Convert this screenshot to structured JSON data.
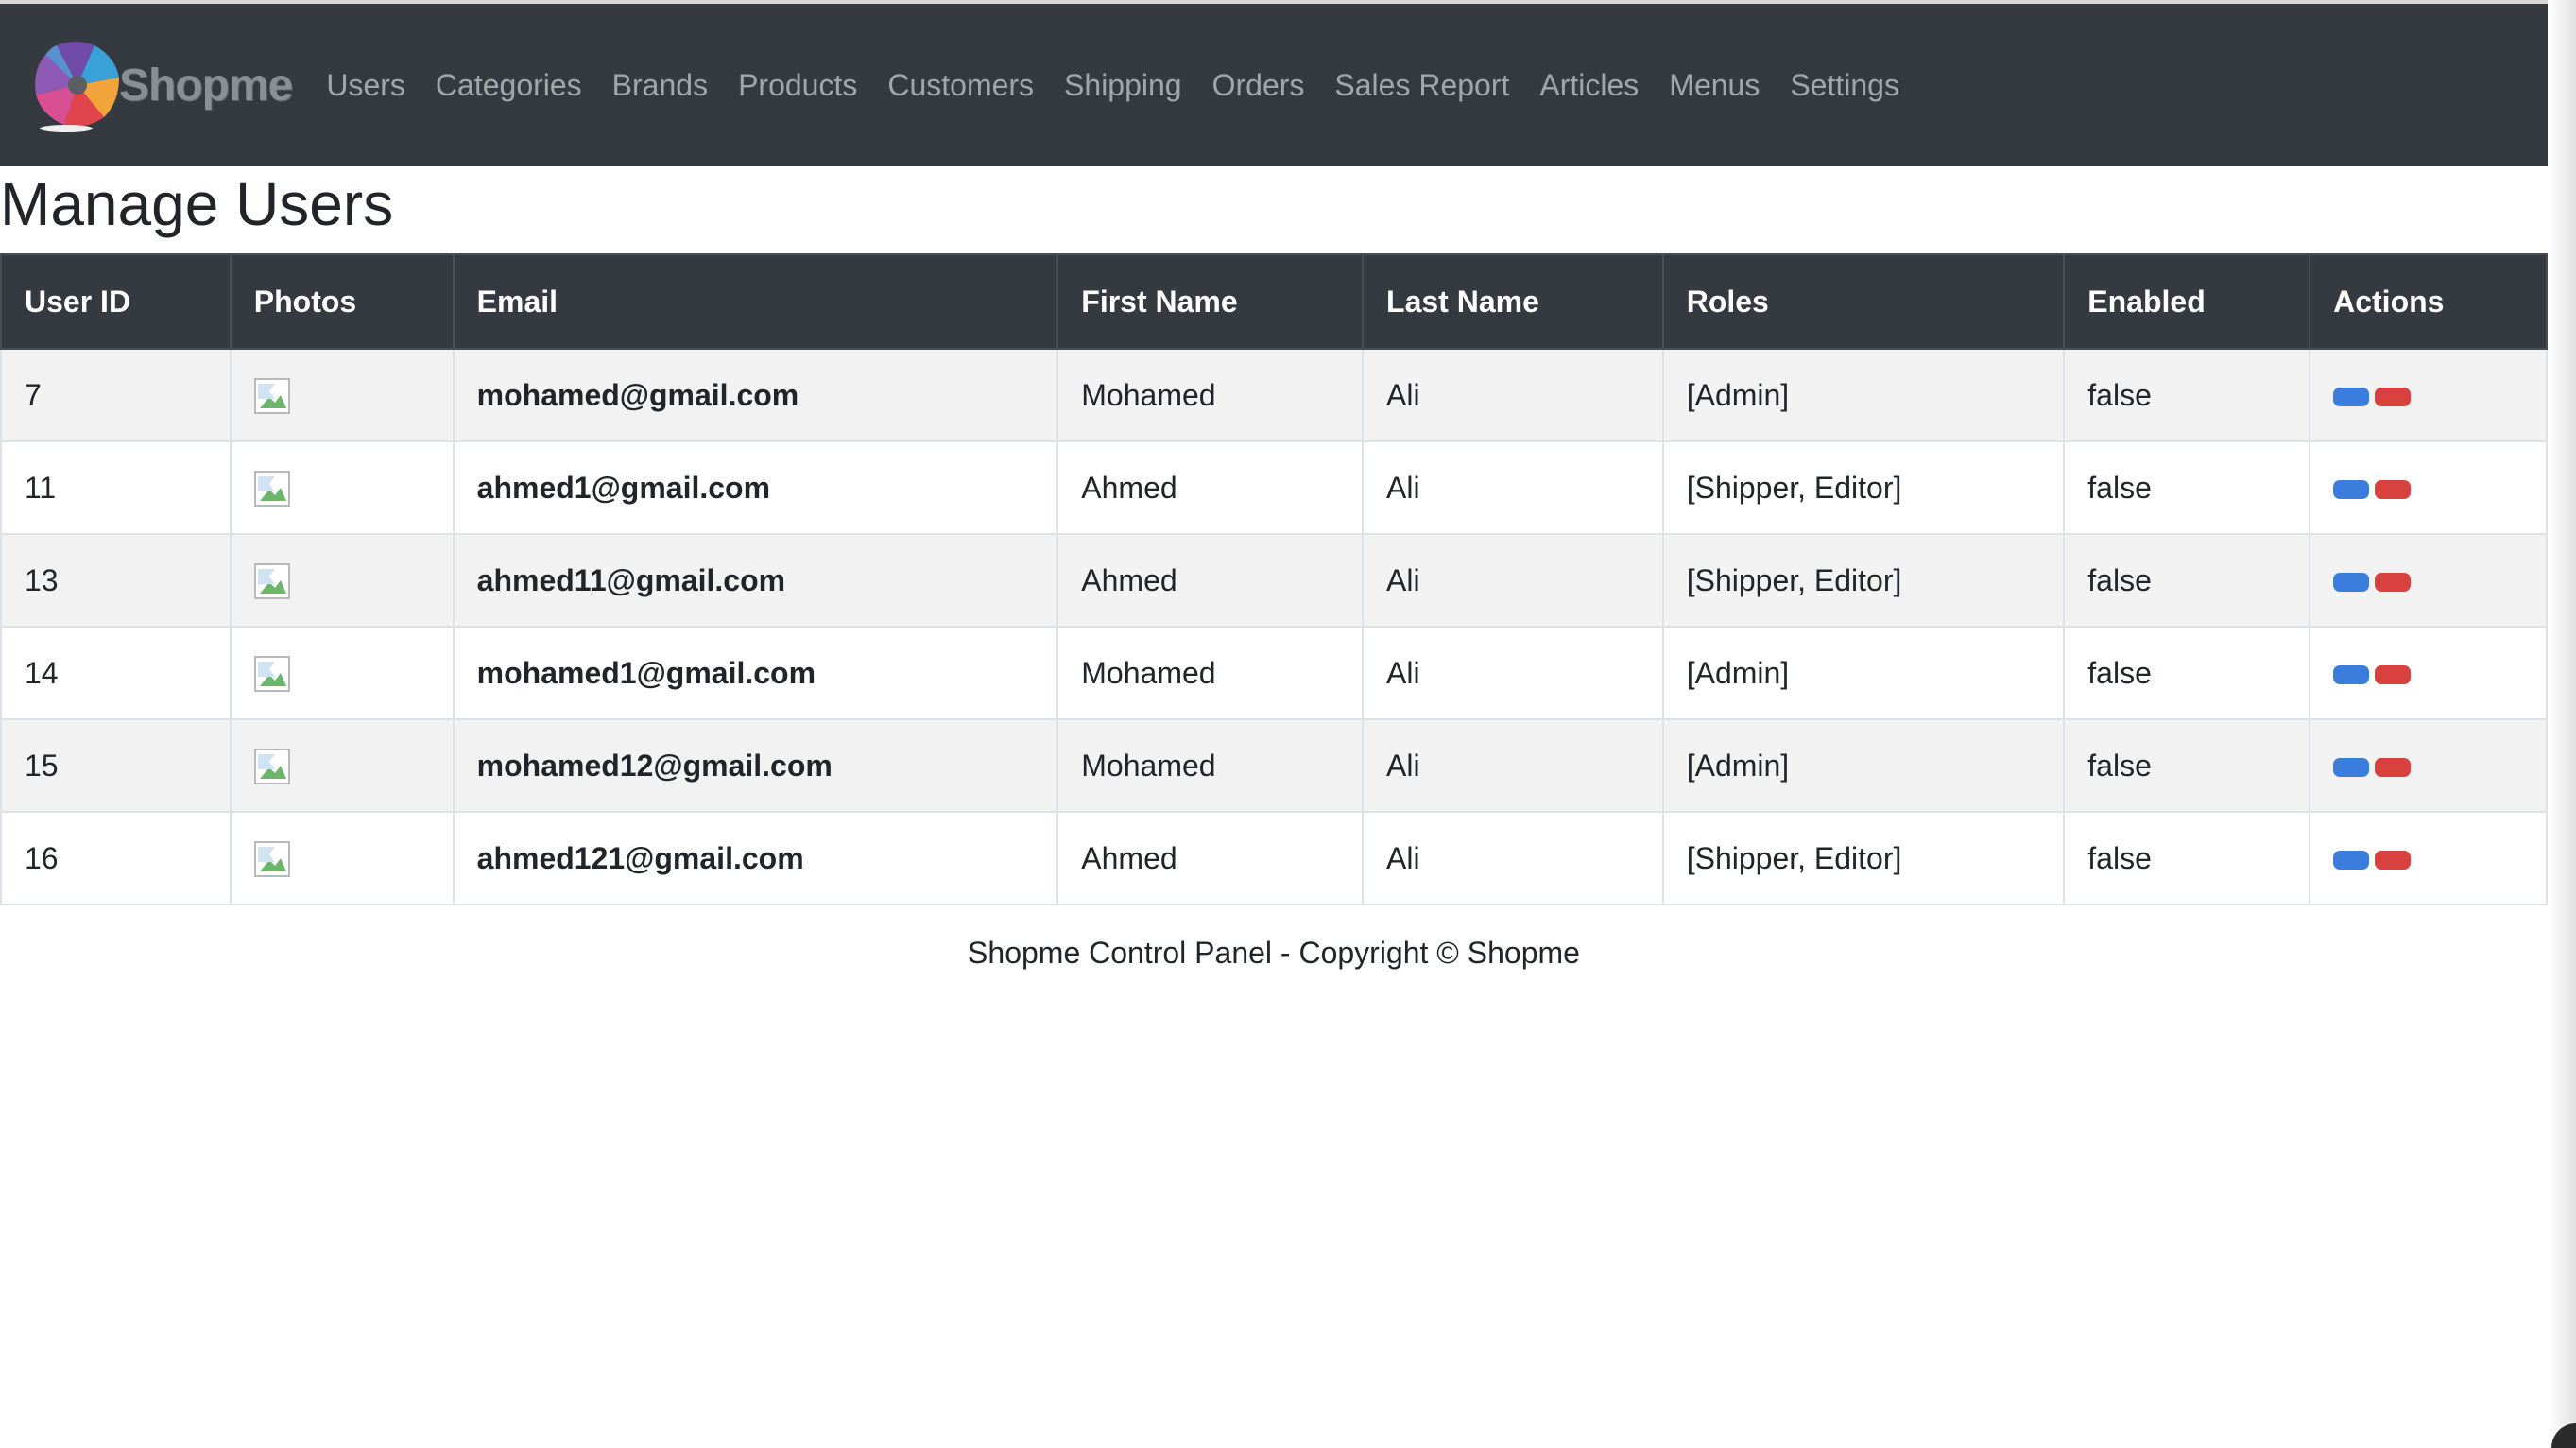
{
  "navbar": {
    "brand": "Shopme",
    "links": [
      {
        "label": "Users"
      },
      {
        "label": "Categories"
      },
      {
        "label": "Brands"
      },
      {
        "label": "Products"
      },
      {
        "label": "Customers"
      },
      {
        "label": "Shipping"
      },
      {
        "label": "Orders"
      },
      {
        "label": "Sales Report"
      },
      {
        "label": "Articles"
      },
      {
        "label": "Menus"
      },
      {
        "label": "Settings"
      }
    ]
  },
  "page": {
    "title": "Manage Users"
  },
  "table": {
    "headers": [
      "User ID",
      "Photos",
      "Email",
      "First Name",
      "Last Name",
      "Roles",
      "Enabled",
      "Actions"
    ],
    "rows": [
      {
        "id": "7",
        "email": "mohamed@gmail.com",
        "first_name": "Mohamed",
        "last_name": "Ali",
        "roles": "[Admin]",
        "enabled": "false"
      },
      {
        "id": "11",
        "email": "ahmed1@gmail.com",
        "first_name": "Ahmed",
        "last_name": "Ali",
        "roles": "[Shipper, Editor]",
        "enabled": "false"
      },
      {
        "id": "13",
        "email": "ahmed11@gmail.com",
        "first_name": "Ahmed",
        "last_name": "Ali",
        "roles": "[Shipper, Editor]",
        "enabled": "false"
      },
      {
        "id": "14",
        "email": "mohamed1@gmail.com",
        "first_name": "Mohamed",
        "last_name": "Ali",
        "roles": "[Admin]",
        "enabled": "false"
      },
      {
        "id": "15",
        "email": "mohamed12@gmail.com",
        "first_name": "Mohamed",
        "last_name": "Ali",
        "roles": "[Admin]",
        "enabled": "false"
      },
      {
        "id": "16",
        "email": "ahmed121@gmail.com",
        "first_name": "Ahmed",
        "last_name": "Ali",
        "roles": "[Shipper, Editor]",
        "enabled": "false"
      }
    ]
  },
  "footer": {
    "text": "Shopme Control Panel - Copyright © Shopme"
  },
  "colors": {
    "navbar_bg": "#343a40",
    "edit_button": "#3b7ddd",
    "delete_button": "#d9413f"
  },
  "icons": {
    "photo": "broken-image-icon",
    "edit": "edit-button",
    "delete": "delete-button"
  }
}
